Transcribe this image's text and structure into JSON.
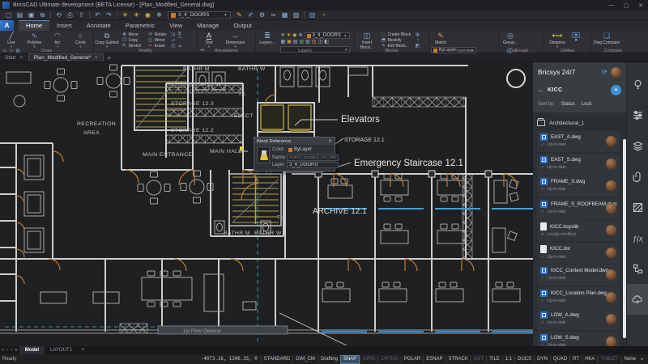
{
  "window": {
    "title": "BricsCAD Ultimate development (BETA License) - [Plan_Modified_General.dwg]",
    "controls": {
      "minimize": "—",
      "maximize": "▢",
      "close": "✕"
    }
  },
  "qat": {
    "left_icons": [
      {
        "name": "new-file",
        "glyph": "▢"
      },
      {
        "name": "open-file",
        "glyph": "▤"
      },
      {
        "name": "save",
        "glyph": "▣"
      },
      {
        "name": "save-all",
        "glyph": "⧉"
      },
      {
        "name": "workspace-switch",
        "glyph": "⟲"
      },
      {
        "name": "print",
        "glyph": "⎙"
      },
      {
        "name": "publish",
        "glyph": "⇪"
      },
      {
        "name": "undo",
        "glyph": "↶"
      },
      {
        "name": "redo",
        "glyph": "↷"
      }
    ],
    "layer_icons": [
      {
        "name": "layer-on",
        "glyph": "☀"
      },
      {
        "name": "layer-thaw",
        "glyph": "☀"
      },
      {
        "name": "layer-lock",
        "glyph": "◉"
      },
      {
        "name": "layer-freeze",
        "glyph": "❄"
      }
    ],
    "layer_combo": "3_4_DOORS",
    "right_icons": [
      {
        "name": "match-properties",
        "glyph": "✎"
      },
      {
        "name": "edit-entity",
        "glyph": "✐"
      },
      {
        "name": "settings",
        "glyph": "⚙"
      },
      {
        "name": "chain",
        "glyph": "∞"
      },
      {
        "name": "table",
        "glyph": "▦"
      },
      {
        "name": "image-attach",
        "glyph": "▧"
      },
      {
        "name": "sheet",
        "glyph": "▥"
      },
      {
        "name": "recent",
        "glyph": "◔"
      }
    ]
  },
  "ribbon": {
    "tabs": [
      "Home",
      "Insert",
      "Annotate",
      "Parametric",
      "View",
      "Manage",
      "Output"
    ],
    "active_tab": "Home",
    "draw": {
      "label": "Draw",
      "line": "Line",
      "polyline": "Polyline",
      "arc": "Arc",
      "circle": "Circle"
    },
    "modify": {
      "label": "Modify",
      "big": "Copy Guided",
      "move": "Move",
      "copy": "Copy",
      "stretch": "Stretch",
      "rotate": "Rotate",
      "mirror": "Mirror",
      "erase": "Erase"
    },
    "annotations": {
      "label": "Annotations",
      "text": "Text",
      "dimension": "Dimension"
    },
    "layers": {
      "label": "Layers",
      "big": "Layers...",
      "combo": "3_4_DOORS"
    },
    "blocks": {
      "label": "Blocks",
      "big": "Insert Block...",
      "create": "Create Block",
      "blockify": "Blockify",
      "edit": "Edit Block..."
    },
    "properties": {
      "label": "Properties",
      "big": "Match",
      "row1": "ByLayer",
      "row2": "ByLayer",
      "row3": "ByLayer"
    },
    "groups": {
      "label": "Groups",
      "group": "Group...",
      "ungroup": "Ungroup..."
    },
    "utilities": {
      "label": "Utilities",
      "big": "Distance"
    },
    "compare": {
      "label": "Compare",
      "big": "Dwg Compare"
    }
  },
  "doc_tabs": {
    "start": "Start",
    "active": "Plan_Modified_General*",
    "close": "✕",
    "add": "+"
  },
  "canvas": {
    "labels": [
      "RECREATION",
      "AREA",
      "STORAGE 12.3",
      "STORAGE 12.2",
      "MAIN ENTRANCE",
      "BATHR M",
      "BATHR W",
      "T.I.",
      "ELECT",
      "MAIN HALL",
      "T.I.",
      "T.I.",
      "BATHR M",
      "BATHR W",
      "STORAGE 12.1",
      "Elevators",
      "Emergency Staircase 12.1",
      "ARCHIVE 12.1",
      "1st Floor General"
    ],
    "popup": {
      "title": "Block Reference",
      "close": "✕",
      "color_label": "Color",
      "color_value": "ByLayer",
      "name_label": "Name",
      "name_value": "PORTA_DOUBLE_INT_20R",
      "layer_label": "Layer",
      "layer_value": "3_4_DOORS"
    },
    "accent_colors": {
      "walls": "#cdcdcd",
      "doors": "#c07a30",
      "stairs": "#b7a24b",
      "glazing": "#3f9fd4",
      "guide": "#2f9e8a"
    }
  },
  "panel247": {
    "title": "Bricsys 24/7",
    "breadcrumb": "KICC",
    "back_glyph": "←",
    "add_glyph": "+",
    "sort_label": "Sort by:",
    "sort_status": "Status",
    "sort_lock": "Lock",
    "folder": "Architectural_1",
    "files": [
      {
        "name": "EAST_A.dwg",
        "status": "Up-to-date",
        "kind": "dwg"
      },
      {
        "name": "EAST_S.dwg",
        "status": "Up-to-date",
        "kind": "dwg"
      },
      {
        "name": "FRAME_S.dwg",
        "status": "Up-to-date",
        "kind": "dwg"
      },
      {
        "name": "FRAME_S_ROOFBEAM.dwg",
        "status": "Up-to-date",
        "kind": "dwg"
      },
      {
        "name": "KICC.bsyslib",
        "status": "Locally modified",
        "kind": "file"
      },
      {
        "name": "KICC.dst",
        "status": "Up-to-date",
        "kind": "file"
      },
      {
        "name": "KICC_Context Model.dwg",
        "status": "Up-to-date",
        "kind": "dwg"
      },
      {
        "name": "KICC_Location Plan.dwg",
        "status": "Up-to-date",
        "kind": "dwg"
      },
      {
        "name": "LOW_A.dwg",
        "status": "Up-to-date",
        "kind": "dwg"
      },
      {
        "name": "LOW_S.dwg",
        "status": "Up-to-date",
        "kind": "dwg"
      }
    ],
    "status_ok_glyph": "✓",
    "status_edit_glyph": "✎"
  },
  "layout_bar": {
    "nav": [
      "«",
      "‹",
      "›",
      "»"
    ],
    "model": "Model",
    "layout": "LAYOUT1",
    "add": "+"
  },
  "status": {
    "ready": "Ready",
    "coords": "-4073.16, 1396.35, 0",
    "toggles": [
      {
        "label": "STANDARD",
        "state": "on"
      },
      {
        "label": "DIM_CM",
        "state": "on"
      },
      {
        "label": "Drafting",
        "state": "on"
      },
      {
        "label": "SNAP",
        "state": "hl"
      },
      {
        "label": "GRID",
        "state": "off"
      },
      {
        "label": "ORTHO",
        "state": "off"
      },
      {
        "label": "POLAR",
        "state": "on"
      },
      {
        "label": "ESNAP",
        "state": "on"
      },
      {
        "label": "STRACK",
        "state": "on"
      },
      {
        "label": "LWT",
        "state": "off"
      },
      {
        "label": "TILE",
        "state": "on"
      },
      {
        "label": "1:1",
        "state": "on"
      },
      {
        "label": "DUCS",
        "state": "on"
      },
      {
        "label": "DYN",
        "state": "on"
      },
      {
        "label": "QUAD",
        "state": "on"
      },
      {
        "label": "RT",
        "state": "on"
      },
      {
        "label": "HKA",
        "state": "on"
      },
      {
        "label": "TABLET",
        "state": "off"
      },
      {
        "label": "None",
        "state": "on"
      }
    ],
    "caret": "▾"
  }
}
